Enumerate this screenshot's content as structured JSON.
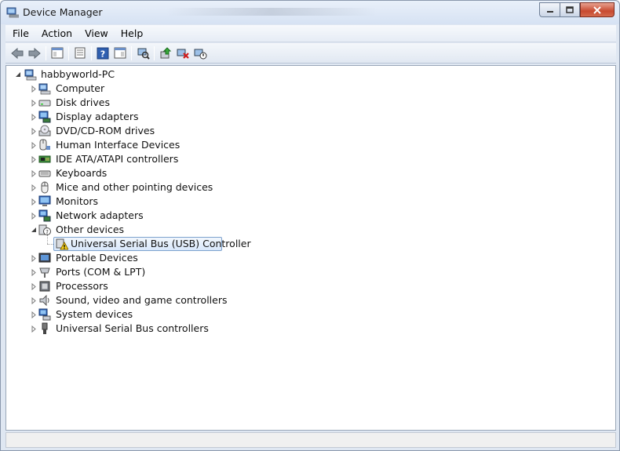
{
  "window": {
    "title": "Device Manager"
  },
  "menu": [
    "File",
    "Action",
    "View",
    "Help"
  ],
  "toolbar": {
    "buttons": [
      {
        "name": "back-button",
        "icon": "arrow-left-icon"
      },
      {
        "name": "forward-button",
        "icon": "arrow-right-icon"
      },
      {
        "name": "show-hide-console-tree-button",
        "icon": "console-tree-icon"
      },
      {
        "name": "properties-button",
        "icon": "properties-icon"
      },
      {
        "name": "help-button",
        "icon": "help-icon"
      },
      {
        "name": "show-hide-action-pane-button",
        "icon": "action-pane-icon"
      },
      {
        "name": "scan-hardware-button",
        "icon": "scan-hardware-icon"
      },
      {
        "name": "update-driver-button",
        "icon": "update-driver-icon"
      },
      {
        "name": "uninstall-button",
        "icon": "uninstall-icon"
      },
      {
        "name": "disable-button",
        "icon": "disable-icon"
      }
    ]
  },
  "tree": {
    "root": {
      "label": "habbyworld-PC",
      "icon": "computer-root-icon",
      "expanded": true
    },
    "categories": [
      {
        "label": "Computer",
        "icon": "computer-icon",
        "expanded": false
      },
      {
        "label": "Disk drives",
        "icon": "disk-drive-icon",
        "expanded": false
      },
      {
        "label": "Display adapters",
        "icon": "display-adapter-icon",
        "expanded": false
      },
      {
        "label": "DVD/CD-ROM drives",
        "icon": "dvd-drive-icon",
        "expanded": false
      },
      {
        "label": "Human Interface Devices",
        "icon": "hid-icon",
        "expanded": false
      },
      {
        "label": "IDE ATA/ATAPI controllers",
        "icon": "ide-controller-icon",
        "expanded": false
      },
      {
        "label": "Keyboards",
        "icon": "keyboard-icon",
        "expanded": false
      },
      {
        "label": "Mice and other pointing devices",
        "icon": "mouse-icon",
        "expanded": false
      },
      {
        "label": "Monitors",
        "icon": "monitor-icon",
        "expanded": false
      },
      {
        "label": "Network adapters",
        "icon": "network-adapter-icon",
        "expanded": false
      },
      {
        "label": "Other devices",
        "icon": "unknown-device-icon",
        "expanded": true,
        "children": [
          {
            "label": "Universal Serial Bus (USB) Controller",
            "icon": "warning-device-icon",
            "selected": true
          }
        ]
      },
      {
        "label": "Portable Devices",
        "icon": "portable-device-icon",
        "expanded": false
      },
      {
        "label": "Ports (COM & LPT)",
        "icon": "port-icon",
        "expanded": false
      },
      {
        "label": "Processors",
        "icon": "processor-icon",
        "expanded": false
      },
      {
        "label": "Sound, video and game controllers",
        "icon": "sound-icon",
        "expanded": false
      },
      {
        "label": "System devices",
        "icon": "system-device-icon",
        "expanded": false
      },
      {
        "label": "Universal Serial Bus controllers",
        "icon": "usb-controller-icon",
        "expanded": false
      }
    ]
  },
  "colors": {
    "selection_border": "#7da2ce",
    "selection_fill": "#d9e8fb",
    "close_button": "#c74a30"
  }
}
